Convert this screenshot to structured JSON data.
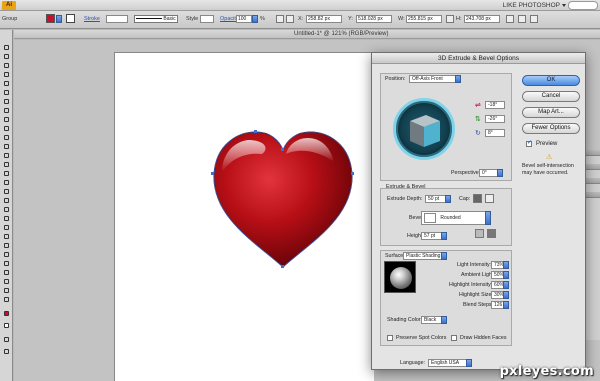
{
  "app": {
    "logo": "Ai",
    "workspace": "LIKE PHOTOSHOP"
  },
  "control_bar": {
    "selection_label": "Group",
    "fill_color": "#c8102e",
    "stroke_label": "Stroke",
    "brush_label": "Basic",
    "style_label": "Style",
    "opacity_label": "Opacity",
    "opacity_value": "100",
    "opacity_unit": "%",
    "x_label": "X:",
    "x_value": "258.82 px",
    "y_label": "Y:",
    "y_value": "518.028 px",
    "w_label": "W:",
    "w_value": "255.815 px",
    "h_label": "H:",
    "h_value": "243.708 px"
  },
  "document": {
    "tab_title": "Untitled-1* @ 121% (RGB/Preview)"
  },
  "dialog": {
    "title": "3D Extrude & Bevel Options",
    "position_label": "Position:",
    "position_value": "Off-Axis Front",
    "rot_x": "-18°",
    "rot_y": "-26°",
    "rot_z": "8°",
    "perspective_label": "Perspective:",
    "perspective_value": "0°",
    "extrude_group": "Extrude & Bevel",
    "extrude_depth_label": "Extrude Depth:",
    "extrude_depth_value": "50 pt",
    "cap_label": "Cap:",
    "bevel_label": "Bevel:",
    "bevel_value": "Rounded",
    "height_label": "Height:",
    "height_value": "57 pt",
    "surface_label": "Surface:",
    "surface_value": "Plastic Shading",
    "light_intensity_label": "Light Intensity:",
    "light_intensity_value": "73%",
    "ambient_light_label": "Ambient Light:",
    "ambient_light_value": "50%",
    "highlight_intensity_label": "Highlight Intensity:",
    "highlight_intensity_value": "60%",
    "highlight_size_label": "Highlight Size:",
    "highlight_size_value": "30%",
    "blend_steps_label": "Blend Steps:",
    "blend_steps_value": "126",
    "shading_color_label": "Shading Color:",
    "shading_color_value": "Black",
    "preserve_spot_label": "Preserve Spot Colors",
    "draw_hidden_label": "Draw Hidden Faces",
    "ok_label": "OK",
    "cancel_label": "Cancel",
    "map_art_label": "Map Art...",
    "fewer_options_label": "Fewer Options",
    "preview_label": "Preview",
    "warning_text": "Bevel self-intersection may have occurred.",
    "language_label": "Language:",
    "language_value": "English USA"
  },
  "colors": {
    "heart": "#c8102e",
    "accent": "#3d72c9",
    "cube": "#4fb3cf"
  },
  "watermark": "pxleyes.com"
}
